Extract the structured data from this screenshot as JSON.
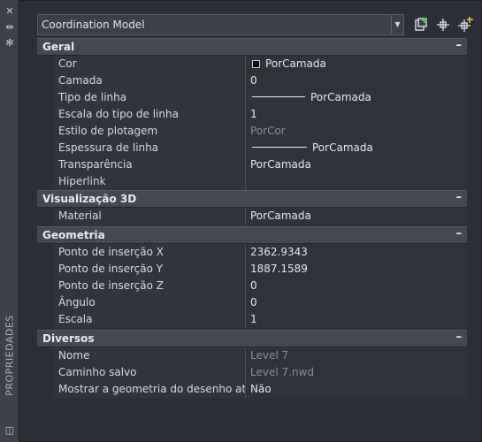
{
  "panel": {
    "title": "PROPRIEDADES"
  },
  "toolbar": {
    "object_combo_value": "Coordination Model",
    "icons": [
      "quick-select-icon",
      "select-objects-icon",
      "toggle-pickadd-icon"
    ]
  },
  "sections": {
    "geral": {
      "title": "Geral",
      "collapse": "–",
      "rows": [
        {
          "name": "Cor",
          "value": "PorCamada"
        },
        {
          "name": "Camada",
          "value": "0"
        },
        {
          "name": "Tipo de linha",
          "value": "PorCamada"
        },
        {
          "name": "Escala do tipo de linha",
          "value": "1"
        },
        {
          "name": "Estilo de plotagem",
          "value": "PorCor"
        },
        {
          "name": "Espessura de linha",
          "value": "PorCamada"
        },
        {
          "name": "Transparência",
          "value": "PorCamada"
        },
        {
          "name": "Hiperlink",
          "value": ""
        }
      ]
    },
    "visualizacao3d": {
      "title": "Visualização 3D",
      "collapse": "–",
      "rows": [
        {
          "name": "Material",
          "value": "PorCamada"
        }
      ]
    },
    "geometria": {
      "title": "Geometria",
      "collapse": "–",
      "rows": [
        {
          "name": "Ponto de inserção X",
          "value": "2362.9343"
        },
        {
          "name": "Ponto de inserção Y",
          "value": "1887.1589"
        },
        {
          "name": "Ponto de inserção Z",
          "value": "0"
        },
        {
          "name": "Ângulo",
          "value": "0"
        },
        {
          "name": "Escala",
          "value": "1"
        }
      ]
    },
    "diversos": {
      "title": "Diversos",
      "collapse": "–",
      "rows": [
        {
          "name": "Nome",
          "value": "Level 7"
        },
        {
          "name": "Caminho salvo",
          "value": "Level 7.nwd"
        },
        {
          "name": "Mostrar a geometria do desenho atual",
          "value": "Não"
        }
      ]
    }
  },
  "colors": {
    "background": "#2b2f36",
    "section_header": "#434953",
    "swatch": "#000000",
    "readonly_text": "#8a9099"
  }
}
